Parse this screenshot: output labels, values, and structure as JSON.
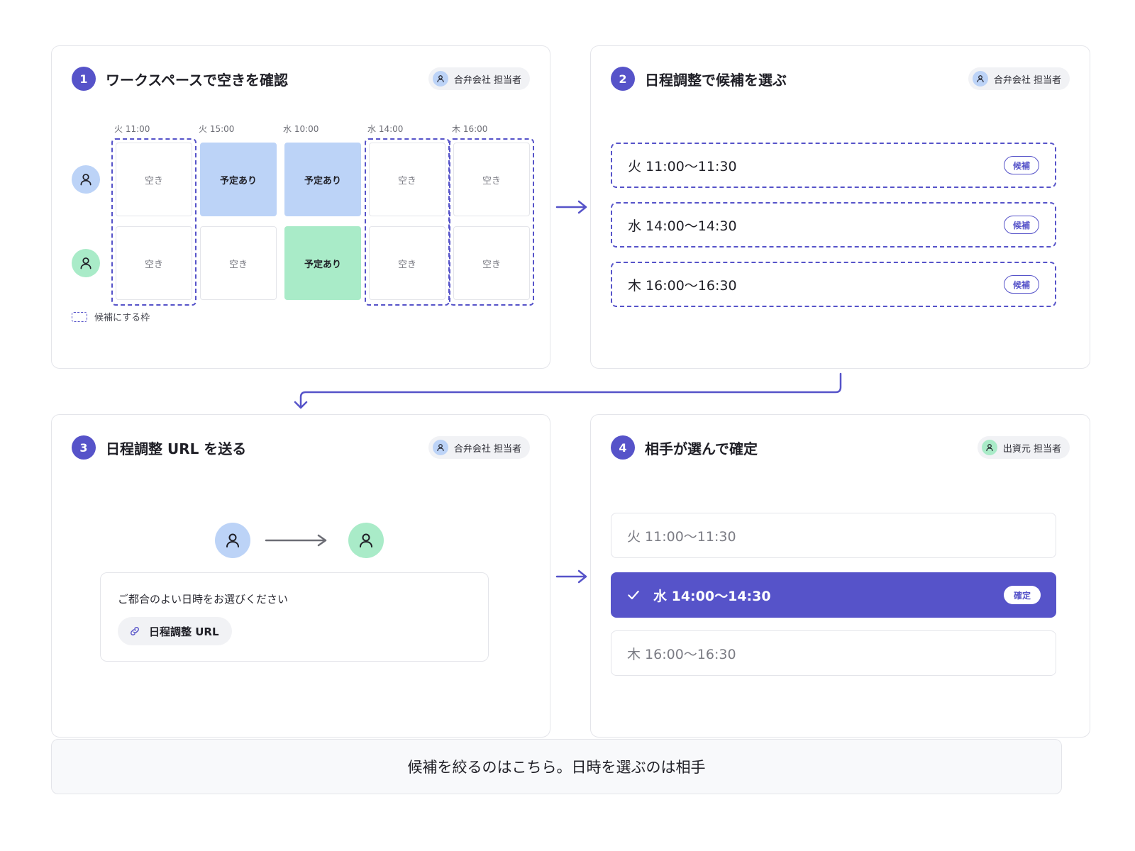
{
  "colors": {
    "accent": "#5653c9",
    "blue_user": "#bcd3f7",
    "green_user": "#a9ebc8"
  },
  "steps": [
    {
      "number": "1",
      "title": "ワークスペースで空きを確認",
      "role": "合弁会社 担当者",
      "columns": [
        "火 11:00",
        "火 15:00",
        "水 10:00",
        "水 14:00",
        "木 16:00"
      ],
      "rows": [
        {
          "user_icon": "user-icon-blue",
          "cells": [
            "空き",
            "予定あり",
            "予定あり",
            "空き",
            "空き"
          ]
        },
        {
          "user_icon": "user-icon-green",
          "cells": [
            "空き",
            "空き",
            "予定あり",
            "空き",
            "空き"
          ]
        }
      ],
      "legend": "候補にする枠"
    },
    {
      "number": "2",
      "title": "日程調整で候補を選ぶ",
      "role": "合弁会社 担当者",
      "slots": [
        {
          "time": "火 11:00〜11:30",
          "tag": "候補"
        },
        {
          "time": "水 14:00〜14:30",
          "tag": "候補"
        },
        {
          "time": "木 16:00〜16:30",
          "tag": "候補"
        }
      ]
    },
    {
      "number": "3",
      "title": "日程調整 URL を送る",
      "role": "合弁会社 担当者",
      "message": "ご都合のよい日時をお選びください",
      "url_label": "日程調整 URL"
    },
    {
      "number": "4",
      "title": "相手が選んで確定",
      "role": "出資元 担当者",
      "slots": [
        {
          "time": "火 11:00〜11:30"
        },
        {
          "time": "水 14:00〜14:30",
          "tag": "確定"
        },
        {
          "time": "木 16:00〜16:30"
        }
      ]
    }
  ],
  "summary": "候補を絞るのはこちら。日時を選ぶのは相手"
}
